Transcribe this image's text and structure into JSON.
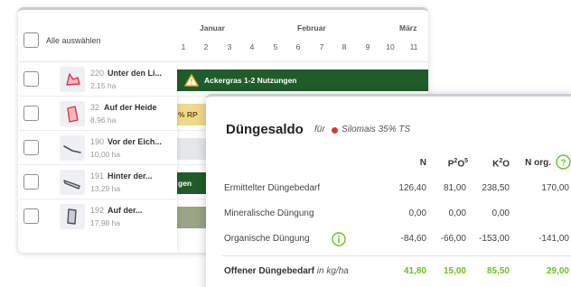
{
  "planner": {
    "select_all_label": "Alle auswählen",
    "months": [
      "Januar",
      "Februar",
      "März"
    ],
    "weeks": [
      "1",
      "2",
      "3",
      "4",
      "5",
      "6",
      "7",
      "8",
      "9",
      "10",
      "11"
    ],
    "fields": [
      {
        "number": "220",
        "name": "Unter den Li...",
        "area": "2,15 ha"
      },
      {
        "number": "32",
        "name": "Auf der Heide",
        "area": "8,96 ha"
      },
      {
        "number": "190",
        "name": "Vor der Eich...",
        "area": "10,00 ha"
      },
      {
        "number": "191",
        "name": "Hinter der...",
        "area": "13,29 ha"
      },
      {
        "number": "192",
        "name": "Auf der...",
        "area": "17,98 ha"
      }
    ],
    "bars": {
      "row1": "Ackergras 1-2 Nutzungen",
      "row2": "% RP",
      "row4": "gen"
    }
  },
  "saldo": {
    "title": "Düngesaldo",
    "fuer": "für",
    "crop": "Silomais 35% TS",
    "columns": [
      "N",
      "P",
      "O",
      "K",
      "O",
      "N org."
    ],
    "col_sup": {
      "p2o5_mid": "2",
      "p2o5_end": "5",
      "k2o_mid": "2"
    },
    "rows": [
      {
        "label": "Ermittelter Düngebedarf",
        "n": "126,40",
        "p": "81,00",
        "k": "238,50",
        "norg": "170,00"
      },
      {
        "label": "Mineralische Düngung",
        "n": "0,00",
        "p": "0,00",
        "k": "0,00",
        "norg": ""
      },
      {
        "label": "Organische Düngung",
        "n": "-84,60",
        "p": "-66,00",
        "k": "-153,00",
        "norg": "-141,00"
      }
    ],
    "total": {
      "label": "Offener Düngebedarf",
      "unit": "in kg/ha",
      "n": "41,80",
      "p": "15,00",
      "k": "85,50",
      "norg": "29,00"
    }
  },
  "colors": {
    "accent_green": "#1f5c2a",
    "positive": "#6cc01f",
    "crop_dot": "#d83a3a",
    "warning": "#f0a526"
  }
}
